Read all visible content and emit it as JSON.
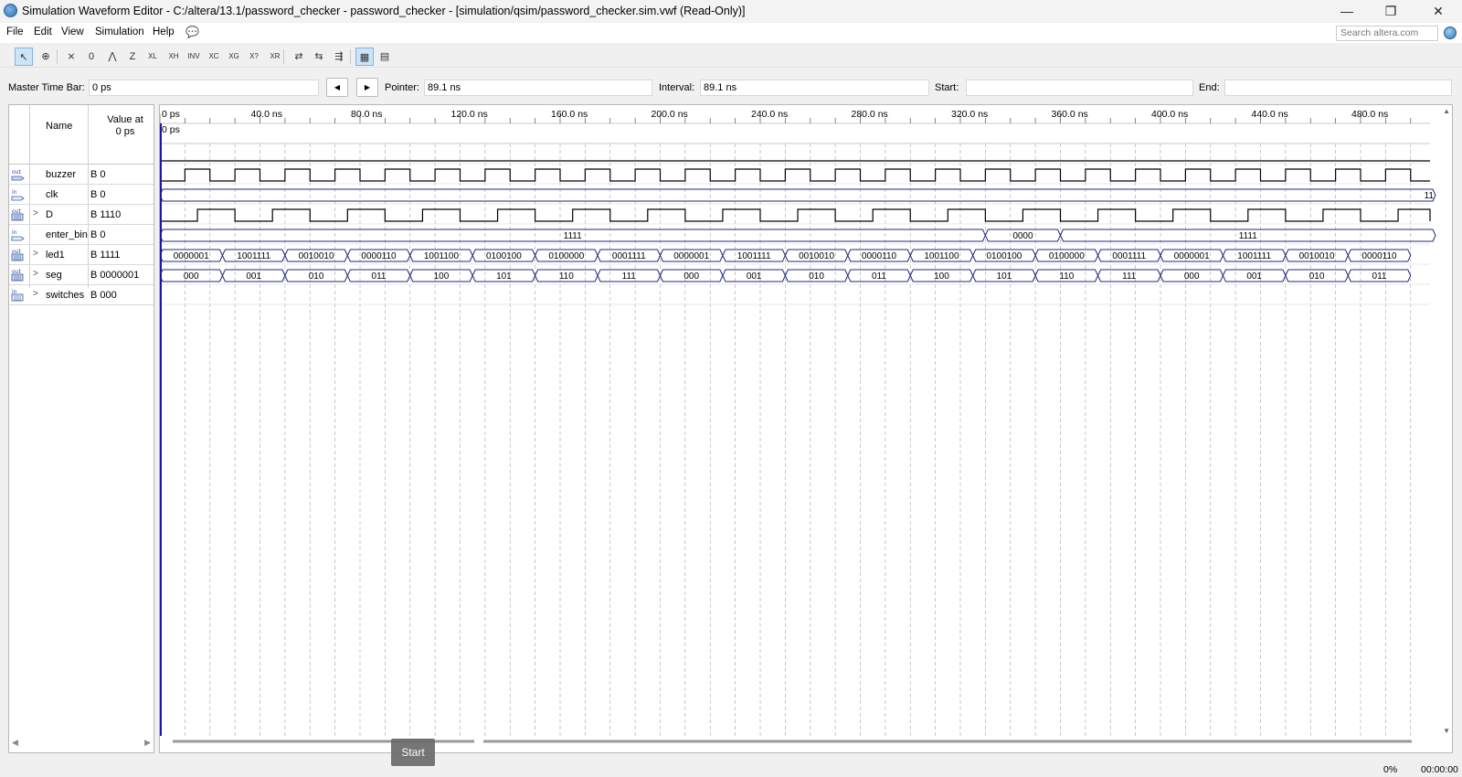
{
  "window": {
    "title": "Simulation Waveform Editor - C:/altera/13.1/password_checker - password_checker - [simulation/qsim/password_checker.sim.vwf (Read-Only)]",
    "minimize": "—",
    "restore": "❐",
    "close": "✕"
  },
  "menu": {
    "file": "File",
    "edit": "Edit",
    "view": "View",
    "simulation": "Simulation",
    "help": "Help",
    "search_placeholder": "Search altera.com"
  },
  "toolbar": {
    "icons": [
      "select-tool-icon",
      "zoom-tool-icon",
      "uninitialized-icon",
      "forcing-low-icon",
      "forcing-high-icon",
      "high-impedance-icon",
      "weak-low-icon",
      "weak-high-icon",
      "invert-icon",
      "count-value-icon",
      "clock-icon",
      "random-value-icon",
      "arbitrary-value-icon",
      "overwrite-icon",
      "snap-to-grid-icon",
      "sort-icon",
      "grid-icon",
      "group-icon"
    ]
  },
  "timebar": {
    "master_label": "Master Time Bar:",
    "master_value": "0 ps",
    "prev": "◀",
    "next": "▶",
    "pointer_label": "Pointer:",
    "pointer_value": "89.1 ns",
    "interval_label": "Interval:",
    "interval_value": "89.1 ns",
    "start_label": "Start:",
    "start_value": "",
    "end_label": "End:",
    "end_value": ""
  },
  "header": {
    "name": "Name",
    "value_line1": "Value at",
    "value_line2": "0 ps"
  },
  "time_axis": {
    "ticks": [
      "0 ps",
      "40.0 ns",
      "80.0 ns",
      "120.0 ns",
      "160.0 ns",
      "200.0 ns",
      "240.0 ns",
      "280.0 ns",
      "320.0 ns",
      "360.0 ns",
      "400.0 ns",
      "440.0 ns",
      "480.0 ns"
    ],
    "cursor_label": "0 ps"
  },
  "signals": [
    {
      "icon": "output-pin-icon",
      "expand": "",
      "name": "buzzer",
      "value": "B 0"
    },
    {
      "icon": "input-pin-icon",
      "expand": "",
      "name": "clk",
      "value": "B 0"
    },
    {
      "icon": "output-bus-icon",
      "expand": ">",
      "name": "D",
      "value": "B 1110"
    },
    {
      "icon": "input-pin-icon",
      "expand": "",
      "name": "enter_bin",
      "value": "B 0"
    },
    {
      "icon": "output-bus-icon",
      "expand": ">",
      "name": "led1",
      "value": "B 1111"
    },
    {
      "icon": "output-bus-icon",
      "expand": ">",
      "name": "seg",
      "value": "B 0000001"
    },
    {
      "icon": "input-bus-icon",
      "expand": ">",
      "name": "switches",
      "value": "B 000"
    }
  ],
  "waveforms": {
    "D_label": "11",
    "led1_segments": [
      "1111",
      "0000",
      "1111"
    ],
    "seg_values": [
      "0000001",
      "1001111",
      "0010010",
      "0000110",
      "1001100",
      "0100100",
      "0100000",
      "0001111",
      "0000001",
      "1001111",
      "0010010",
      "0000110",
      "1001100",
      "0100100",
      "0100000",
      "0001111",
      "0000001",
      "1001111",
      "0010010",
      "0000110"
    ],
    "switches_values": [
      "000",
      "001",
      "010",
      "011",
      "100",
      "101",
      "110",
      "111",
      "000",
      "001",
      "010",
      "011",
      "100",
      "101",
      "110",
      "111",
      "000",
      "001",
      "010",
      "011"
    ]
  },
  "status": {
    "start_button": "Start",
    "progress": "0%",
    "elapsed": "00:00:00"
  },
  "colors": {
    "wave_line": "#000000",
    "bus_line": "#1f2a7a",
    "cursor": "#1a1aa0",
    "grid": "#b0b0b0"
  }
}
